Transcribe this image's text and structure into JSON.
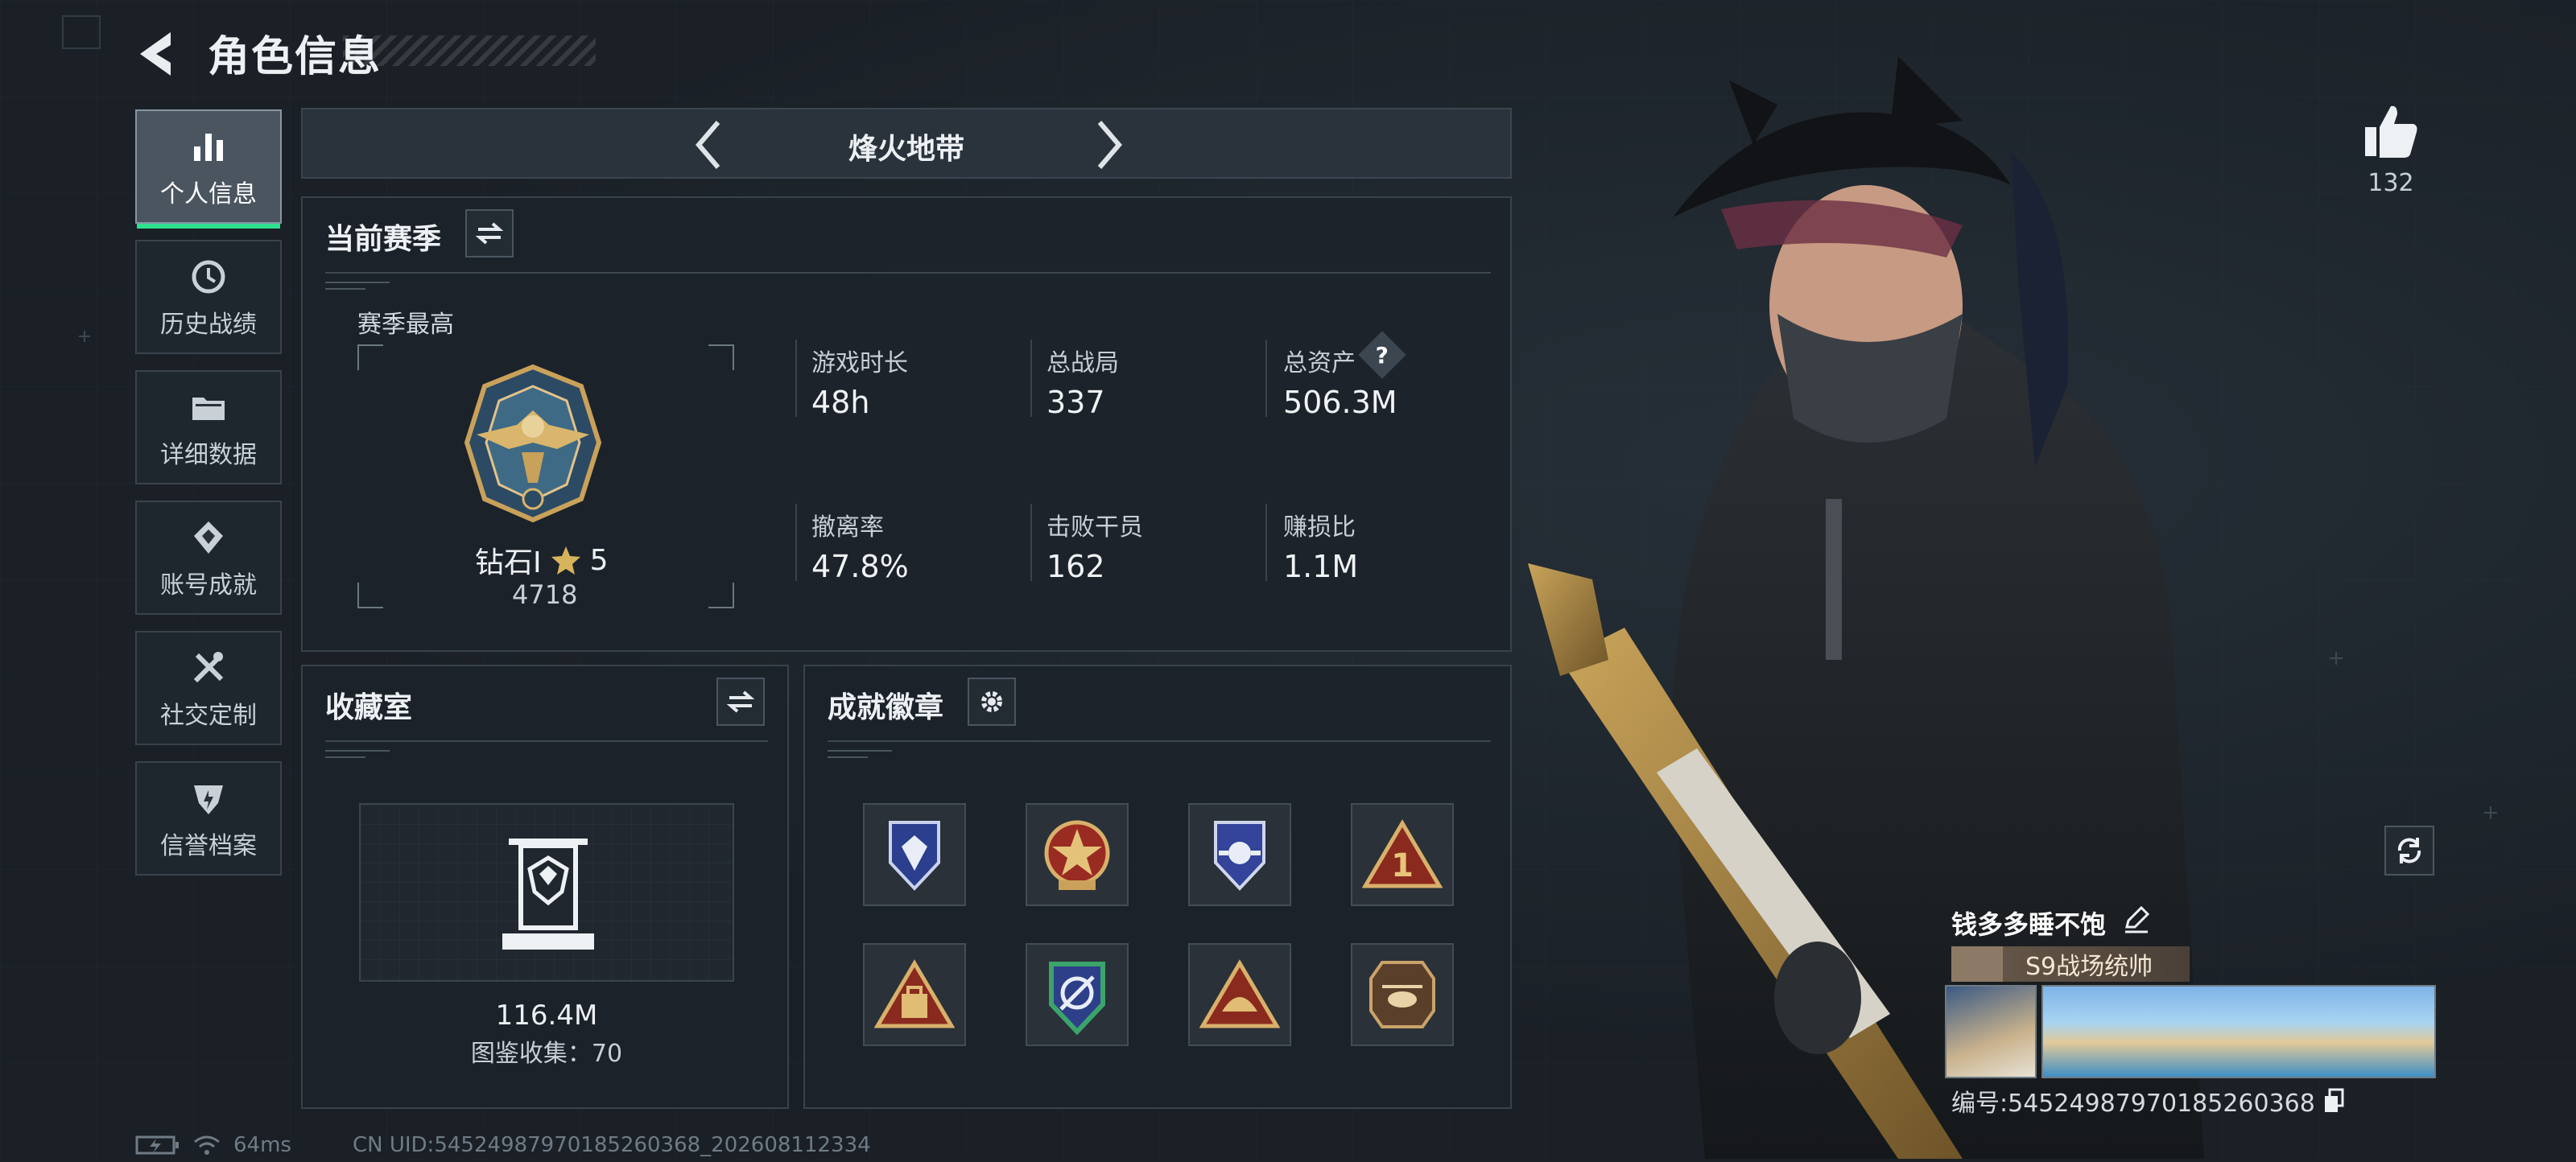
{
  "header": {
    "title": "角色信息"
  },
  "sidebar": {
    "items": [
      {
        "label": "个人信息",
        "icon": "bar-chart-icon",
        "active": true
      },
      {
        "label": "历史战绩",
        "icon": "history-icon"
      },
      {
        "label": "详细数据",
        "icon": "folder-icon"
      },
      {
        "label": "账号成就",
        "icon": "achievement-icon"
      },
      {
        "label": "社交定制",
        "icon": "tools-icon"
      },
      {
        "label": "信誉档案",
        "icon": "shield-icon"
      }
    ]
  },
  "mode": {
    "title": "烽火地带",
    "prev_icon": "chevron-left-icon",
    "next_icon": "chevron-right-icon"
  },
  "season": {
    "title": "当前赛季",
    "best_label": "赛季最高",
    "rank_name": "钻石I",
    "rank_stars": "5",
    "rank_score": "4718",
    "stats": [
      {
        "label": "游戏时长",
        "value": "48h"
      },
      {
        "label": "总战局",
        "value": "337"
      },
      {
        "label": "总资产",
        "value": "506.3M",
        "help": "?"
      },
      {
        "label": "撤离率",
        "value": "47.8%"
      },
      {
        "label": "击败干员",
        "value": "162"
      },
      {
        "label": "赚损比",
        "value": "1.1M"
      }
    ]
  },
  "collection": {
    "title": "收藏室",
    "value": "116.4M",
    "catalog": "图鉴收集：70"
  },
  "badges": {
    "title": "成就徽章",
    "items": [
      "blue-shield-badge-icon",
      "red-star-badge-icon",
      "blue-wing-badge-icon",
      "gold-triangle-one-badge-icon",
      "gold-triangle-bag-badge-icon",
      "green-compass-badge-icon",
      "gold-triangle-dome-badge-icon",
      "helicopter-badge-icon"
    ]
  },
  "likes": {
    "count": "132"
  },
  "profile": {
    "name": "钱多多睡不饱",
    "title_badge": "S9战场统帅",
    "id_line": "编号:545249879701852603​68"
  },
  "footer": {
    "ping": "64ms",
    "uid": "CN UID:5452498797018526036​8_202608112334"
  },
  "colors": {
    "accent": "#2fe08e",
    "panel": "#1c232a",
    "border": "#38424b"
  }
}
